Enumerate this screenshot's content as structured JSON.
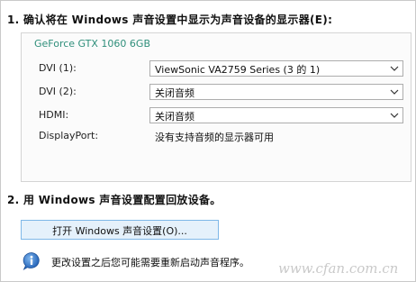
{
  "step1": {
    "heading": "1. 确认将在 Windows 声音设置中显示为声音设备的显示器(E):"
  },
  "group": {
    "title": "GeForce GTX 1060 6GB",
    "rows": [
      {
        "label": "DVI (1):",
        "value": "ViewSonic VA2759 Series (3 的 1)"
      },
      {
        "label": "DVI (2):",
        "value": "关闭音频"
      },
      {
        "label": "HDMI:",
        "value": "关闭音频"
      },
      {
        "label": "DisplayPort:",
        "value": "没有支持音频的显示器可用"
      }
    ]
  },
  "step2": {
    "heading": "2. 用 Windows 声音设置配置回放设备。",
    "button_label": "打开 Windows 声音设置(O)..."
  },
  "info": {
    "text": "更改设置之后您可能需要重新启动声音程序。",
    "icon": "info-icon"
  },
  "watermark": {
    "text": "www.cfan.com.cn"
  }
}
